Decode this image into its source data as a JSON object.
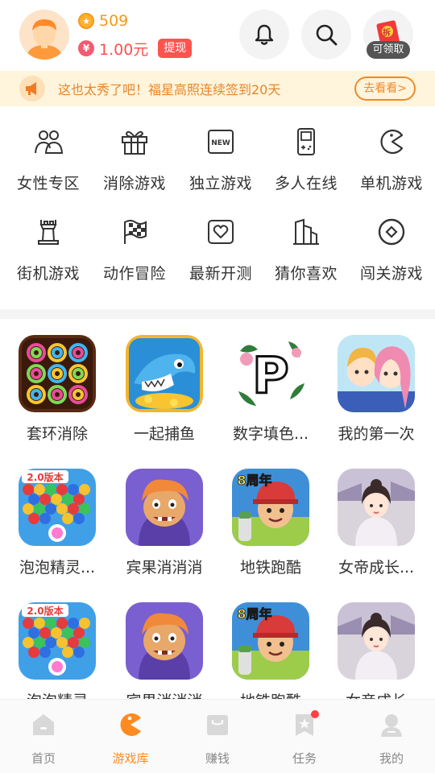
{
  "header": {
    "coins": "509",
    "money": "1.00元",
    "withdraw_label": "提现",
    "redpack_label": "可领取",
    "redpack_badge": "拆"
  },
  "notice": {
    "text": "这也太秀了吧！福星高照连续签到20天",
    "button_label": "去看看>"
  },
  "categories": [
    {
      "label": "女性专区",
      "icon": "female-users-icon"
    },
    {
      "label": "消除游戏",
      "icon": "gift-box-icon"
    },
    {
      "label": "独立游戏",
      "icon": "new-badge-icon"
    },
    {
      "label": "多人在线",
      "icon": "gameboy-icon"
    },
    {
      "label": "单机游戏",
      "icon": "pacman-icon"
    },
    {
      "label": "街机游戏",
      "icon": "castle-tower-icon"
    },
    {
      "label": "动作冒险",
      "icon": "checkered-flag-icon"
    },
    {
      "label": "最新开测",
      "icon": "heart-frame-icon"
    },
    {
      "label": "猜你喜欢",
      "icon": "buildings-icon"
    },
    {
      "label": "闯关游戏",
      "icon": "target-diamond-icon"
    }
  ],
  "games": [
    {
      "name": "套环消除",
      "thumb": "rings-puzzle"
    },
    {
      "name": "一起捕鱼",
      "thumb": "shark-fishing"
    },
    {
      "name": "数字填色...",
      "thumb": "number-coloring"
    },
    {
      "name": "我的第一次",
      "thumb": "anime-couple"
    },
    {
      "name": "泡泡精灵...",
      "thumb": "bubble-shooter"
    },
    {
      "name": "宾果消消消",
      "thumb": "troll-bingo"
    },
    {
      "name": "地铁跑酷",
      "thumb": "subway-runner"
    },
    {
      "name": "女帝成长...",
      "thumb": "empress-girl"
    },
    {
      "name": "泡泡精灵",
      "thumb": "bubble-shooter"
    },
    {
      "name": "宾果消消消",
      "thumb": "troll-bingo"
    },
    {
      "name": "地铁跑酷",
      "thumb": "subway-runner"
    },
    {
      "name": "女帝成长",
      "thumb": "empress-girl"
    }
  ],
  "thumb_texts": {
    "bubble_version": "2.0版本",
    "subway_anniv": "8周年",
    "coloring_letter": "P"
  },
  "tabs": [
    {
      "label": "首页",
      "icon": "home-icon",
      "active": false
    },
    {
      "label": "游戏库",
      "icon": "pacman-icon",
      "active": true
    },
    {
      "label": "赚钱",
      "icon": "wallet-icon",
      "active": false
    },
    {
      "label": "任务",
      "icon": "task-star-icon",
      "active": false
    },
    {
      "label": "我的",
      "icon": "profile-icon",
      "active": false
    }
  ],
  "colors": {
    "accent_orange": "#ff8a1f",
    "coin_gold": "#f39a16",
    "money_red": "#ff4f4f",
    "notice_bg": "#fff4dc",
    "notice_text": "#e8862a"
  }
}
